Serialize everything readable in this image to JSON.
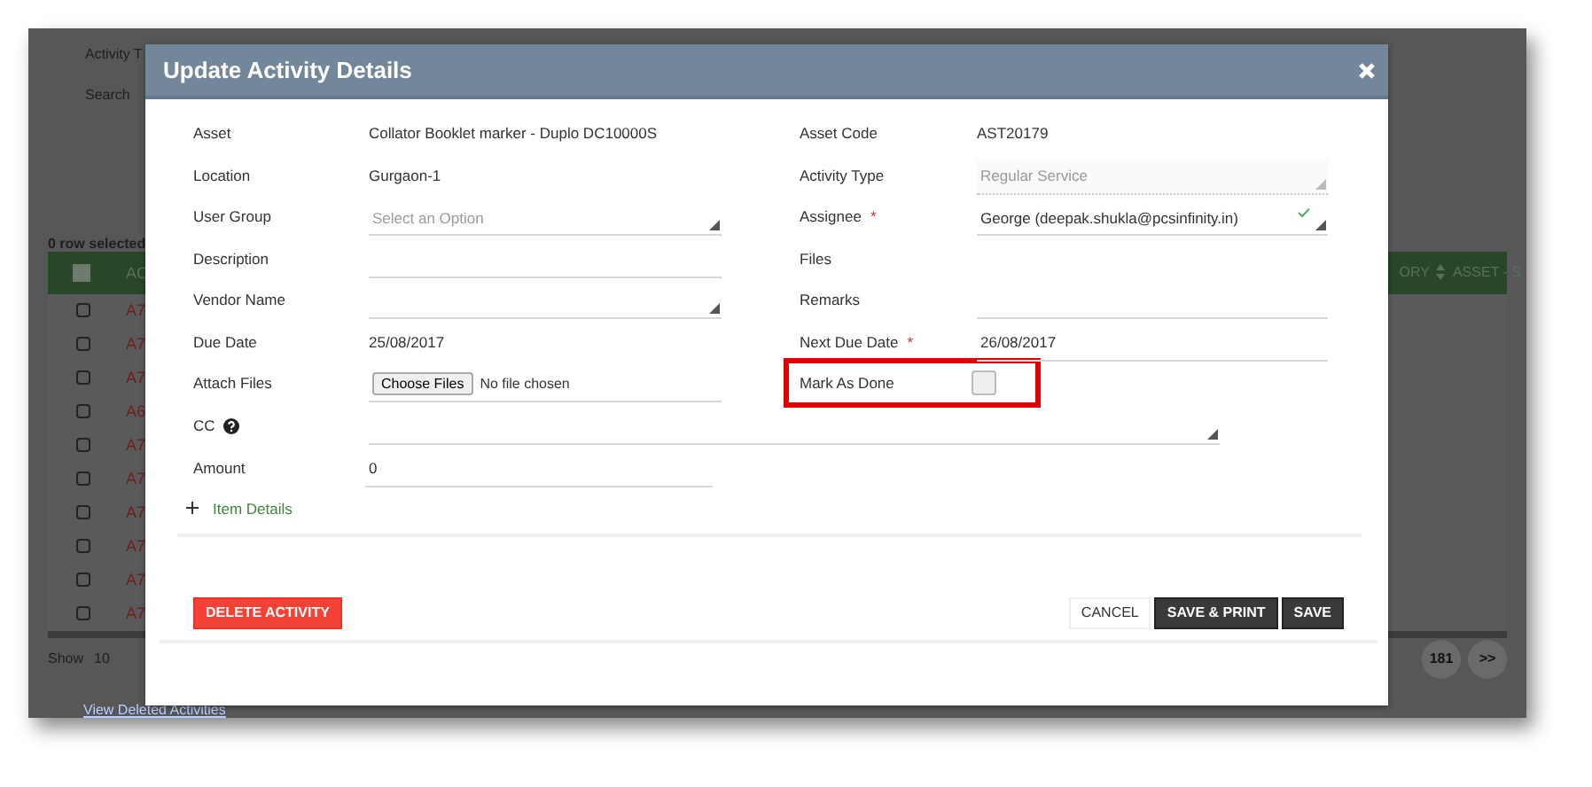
{
  "background": {
    "filters": [
      {
        "label": "Activity T"
      },
      {
        "label": "Search"
      }
    ],
    "selection_count": "0 row selected",
    "table": {
      "select_all_checked": false,
      "columns": [
        "AC",
        "ORY",
        "ASSET - S"
      ],
      "rows": [
        {
          "checked": false,
          "id": "A7"
        },
        {
          "checked": false,
          "id": "A7"
        },
        {
          "checked": false,
          "id": "A7"
        },
        {
          "checked": false,
          "id": "A6"
        },
        {
          "checked": false,
          "id": "A7"
        },
        {
          "checked": false,
          "id": "A7"
        },
        {
          "checked": false,
          "id": "A7"
        },
        {
          "checked": false,
          "id": "A7"
        },
        {
          "checked": false,
          "id": "A7"
        },
        {
          "checked": false,
          "id": "A7"
        }
      ]
    },
    "pagination": {
      "show_label": "Show",
      "page_size": "10",
      "pages": [
        "181",
        ">>"
      ]
    },
    "link": "View Deleted Activities"
  },
  "dialog": {
    "title": "Update Activity Details",
    "required_mark": "*",
    "fields": [
      {
        "label": "Asset",
        "kind": "static",
        "required": false,
        "value": "Collator Booklet marker - Duplo DC10000S"
      },
      {
        "label": "Asset Code",
        "kind": "static",
        "required": false,
        "value": "AST20179"
      },
      {
        "label": "Location",
        "kind": "static",
        "required": false,
        "value": "Gurgaon-1"
      },
      {
        "label": "Activity Type",
        "kind": "select",
        "required": false,
        "value": "Regular Service",
        "disabled": true,
        "valid": false
      },
      {
        "label": "User Group",
        "kind": "select",
        "required": false,
        "placeholder": "Select an Option",
        "disabled": false,
        "valid": false
      },
      {
        "label": "Assignee",
        "kind": "select",
        "required": true,
        "value": "George (deepak.shukla@pcsinfinity.in)",
        "disabled": false,
        "valid": true
      },
      {
        "label": "Description",
        "kind": "input",
        "required": false
      },
      {
        "label": "Files",
        "kind": "none",
        "required": false
      },
      {
        "label": "Vendor Name",
        "kind": "select",
        "required": false,
        "disabled": false,
        "valid": false
      },
      {
        "label": "Remarks",
        "kind": "input",
        "required": false
      },
      {
        "label": "Due Date",
        "kind": "static",
        "required": false,
        "value": "25/08/2017"
      },
      {
        "label": "Next Due Date",
        "kind": "input",
        "required": true,
        "value": "26/08/2017"
      },
      {
        "label": "Attach Files",
        "kind": "file",
        "required": false,
        "button": "Choose Files",
        "status": "No file chosen"
      },
      {
        "label": "Mark As Done",
        "kind": "checkbox",
        "required": false,
        "checked": false,
        "highlighted": true
      }
    ],
    "cc": {
      "label": "CC"
    },
    "amount": {
      "label": "Amount",
      "value": "0"
    },
    "item_details": {
      "label": "Item Details",
      "expanded": false
    },
    "delete_button": "DELETE ACTIVITY",
    "buttons": [
      {
        "label": "CANCEL",
        "kind": "plain"
      },
      {
        "label": "SAVE & PRINT",
        "kind": "dark"
      },
      {
        "label": "SAVE",
        "kind": "dark"
      }
    ]
  }
}
